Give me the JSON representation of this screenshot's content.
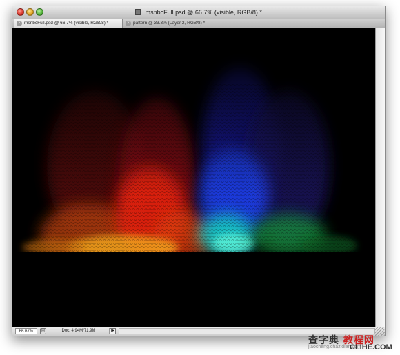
{
  "window": {
    "title": "msnbcFull.psd @ 66.7% (visible, RGB/8) *"
  },
  "tabs": [
    {
      "label": "msnbcFull.psd @ 66.7% (visible, RGB/8) *",
      "active": true
    },
    {
      "label": "pattern @ 33.3% (Layer 2, RGB/8) *",
      "active": false
    }
  ],
  "status": {
    "zoom": "66.67%",
    "doc_info": "Doc: 4.94M/71.9M"
  },
  "watermark": {
    "chinese_left": "查字典",
    "chinese_right": "教程网",
    "pinyin": "jiaocheng.chazidian.com",
    "site": "CLIHE.COM"
  },
  "colors": {
    "canvas_bg": "#000000",
    "window_chrome": "#d6d6d6"
  },
  "icons": {
    "close": "close-circle",
    "minimize": "minimize-circle",
    "maximize": "zoom-circle",
    "tab_close": "x-circle",
    "document": "psd-document",
    "status_toggle": "status-toggle",
    "status_menu": "right-triangle"
  }
}
